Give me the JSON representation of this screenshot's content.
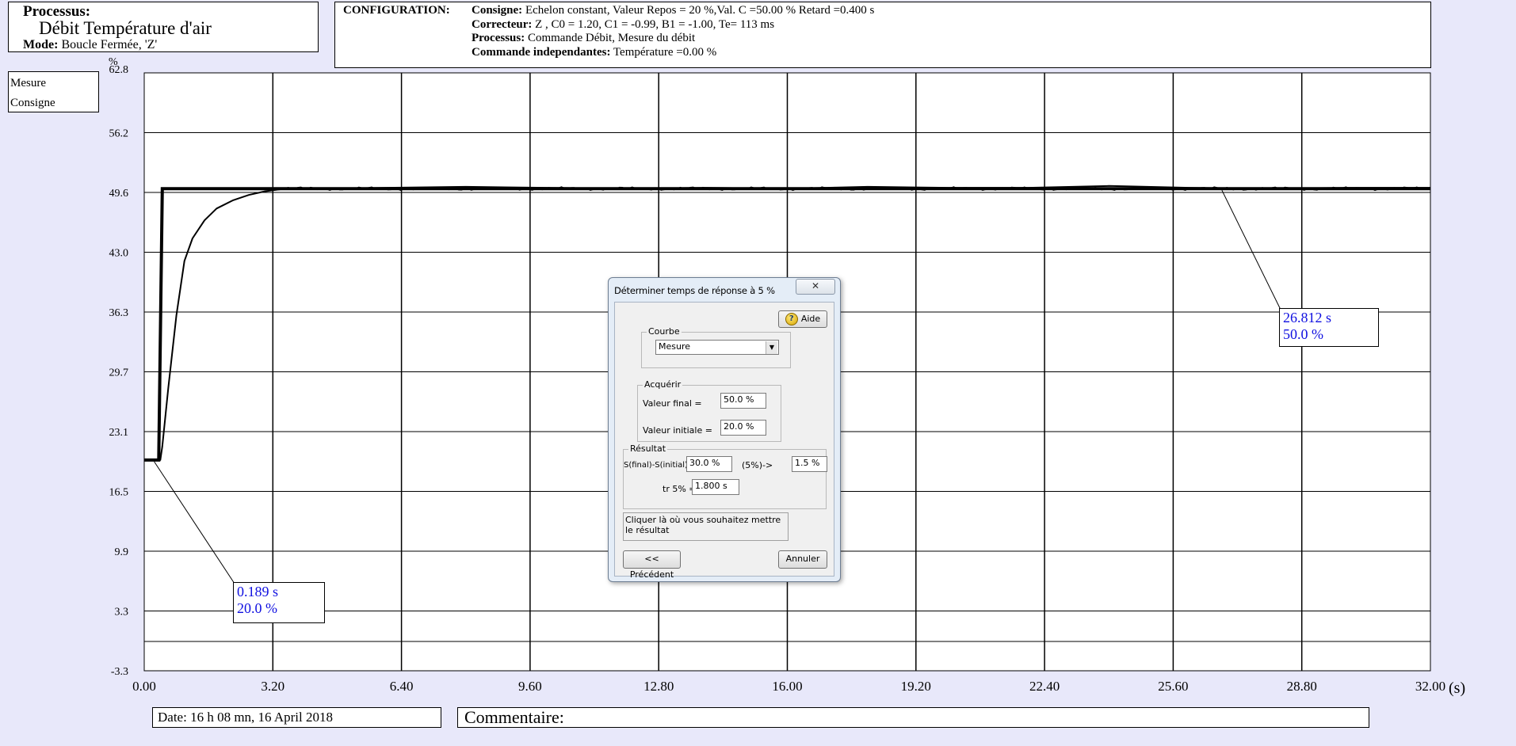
{
  "process": {
    "title": "Processus:",
    "name": "Débit Température d'air",
    "mode_label": "Mode:",
    "mode_value": "Boucle Fermée, 'Z'"
  },
  "config": {
    "header": "CONFIGURATION:",
    "consigne_label": "Consigne:",
    "consigne_value": "Echelon constant, Valeur Repos = 20 %,Val. C =50.00 % Retard =0.400 s",
    "correcteur_label": "Correcteur:",
    "correcteur_value": "Z , C0 = 1.20, C1 = -0.99, B1 = -1.00, Te= 113 ms",
    "processus_label": "Processus:",
    "processus_value": "Commande Débit, Mesure du débit",
    "commande_label": "Commande independantes:",
    "commande_value": "Température =0.00 %"
  },
  "legend": {
    "items": [
      "Mesure",
      "Consigne"
    ]
  },
  "chart_data": {
    "type": "line",
    "ylabel": "%",
    "xlabel": "(s)",
    "ylim": [
      -3.3,
      62.8
    ],
    "xlim": [
      0,
      32
    ],
    "y_ticks": [
      "62.8",
      "56.2",
      "49.6",
      "43.0",
      "36.3",
      "29.7",
      "23.1",
      "16.5",
      "9.9",
      "3.3",
      "-3.3"
    ],
    "x_ticks": [
      "0.00",
      "3.20",
      "6.40",
      "9.60",
      "12.80",
      "16.00",
      "19.20",
      "22.40",
      "25.60",
      "28.80",
      "32.00"
    ],
    "grid": true,
    "legend_position": "top-left",
    "series": [
      {
        "name": "Consigne",
        "x": [
          0,
          0.35,
          0.36,
          0.45,
          0.46,
          32
        ],
        "y": [
          20,
          20,
          20,
          50,
          50,
          50
        ]
      },
      {
        "name": "Mesure",
        "x": [
          0,
          0.4,
          0.45,
          0.6,
          0.8,
          1.0,
          1.2,
          1.5,
          1.8,
          2.2,
          2.6,
          3.0,
          3.5,
          4.5,
          6,
          8,
          10,
          12,
          14,
          16,
          18,
          20,
          22,
          24,
          26,
          28,
          30,
          32
        ],
        "y": [
          20,
          20,
          21.5,
          28,
          36,
          42,
          44.5,
          46.5,
          47.8,
          48.7,
          49.3,
          49.7,
          50,
          50,
          50.1,
          50.2,
          50.1,
          50,
          50.1,
          50,
          50.2,
          50.1,
          50.1,
          50.3,
          50.1,
          50,
          50.1,
          50.1
        ]
      }
    ],
    "annotations": [
      {
        "line1": "0.189 s",
        "line2": "20.0 %",
        "x": 0.189,
        "y": 20.0
      },
      {
        "line1": "26.812 s",
        "line2": "50.0 %",
        "x": 26.812,
        "y": 50.0
      }
    ]
  },
  "footer": {
    "date": "Date: 16 h 08 mn, 16 April 2018",
    "comment_label": "Commentaire:"
  },
  "dialog": {
    "title": "Déterminer temps de réponse à 5 %",
    "close_glyph": "✕",
    "help_label": "Aide",
    "courbe_group": "Courbe",
    "courbe_value": "Mesure",
    "acquerir_group": "Acquérir",
    "valeur_final_label": "Valeur final =",
    "valeur_final_value": "50.0 %",
    "valeur_initiale_label": "Valeur initiale =",
    "valeur_initiale_value": "20.0 %",
    "resultat_group": "Résultat",
    "diff_label": "S(final)-S(initial) =",
    "diff_value": "30.0 %",
    "pct_label": "(5%)->",
    "pct_value": "1.5 %",
    "tr_label": "tr 5% =",
    "tr_value": "1.800 s",
    "instruction": "Cliquer là où vous souhaitez mettre le résultat",
    "prev_button": "<< Précédent",
    "cancel_button": "Annuler"
  }
}
